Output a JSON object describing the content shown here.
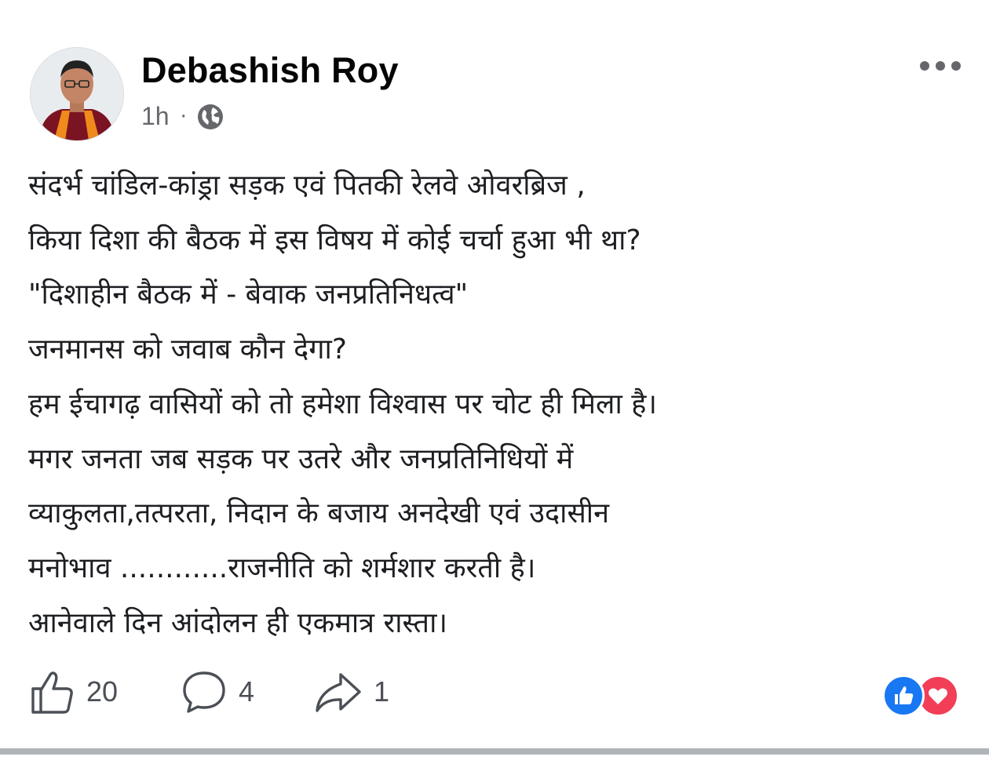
{
  "post": {
    "author": "Debashish Roy",
    "time": "1h",
    "separator": "·",
    "privacy_icon": "globe-icon",
    "more_icon": "more-horizontal-icon",
    "lines": [
      "संदर्भ चांडिल-कांड्रा सड़क एवं पितकी रेलवे ओवरब्रिज ,",
      "किया दिशा की बैठक में इस विषय में कोई चर्चा हुआ भी था?",
      "\"दिशाहीन बैठक में - बेवाक जनप्रतिनिधत्व\"",
      "जनमानस को जवाब कौन देगा?",
      "हम ईचागढ़ वासियों को तो हमेशा विश्वास पर चोट ही मिला है।",
      "मगर जनता जब सड़क पर उतरे और जनप्रतिनिधियों में",
      "व्याकुलता,तत्परता, निदान के बजाय अनदेखी एवं उदासीन",
      "मनोभाव ............राजनीति को शर्मशार करती है।",
      "आनेवाले दिन आंदोलन ही एकमात्र रास्ता।"
    ]
  },
  "actions": {
    "like": {
      "icon": "thumbs-up-icon",
      "count": "20"
    },
    "comment": {
      "icon": "comment-icon",
      "count": "4"
    },
    "share": {
      "icon": "share-icon",
      "count": "1"
    }
  },
  "reactions": [
    "like-reaction-icon",
    "love-reaction-icon"
  ],
  "colors": {
    "like_blue": "#1877f2",
    "love_red": "#f33e58",
    "secondary_text": "#65676b"
  }
}
